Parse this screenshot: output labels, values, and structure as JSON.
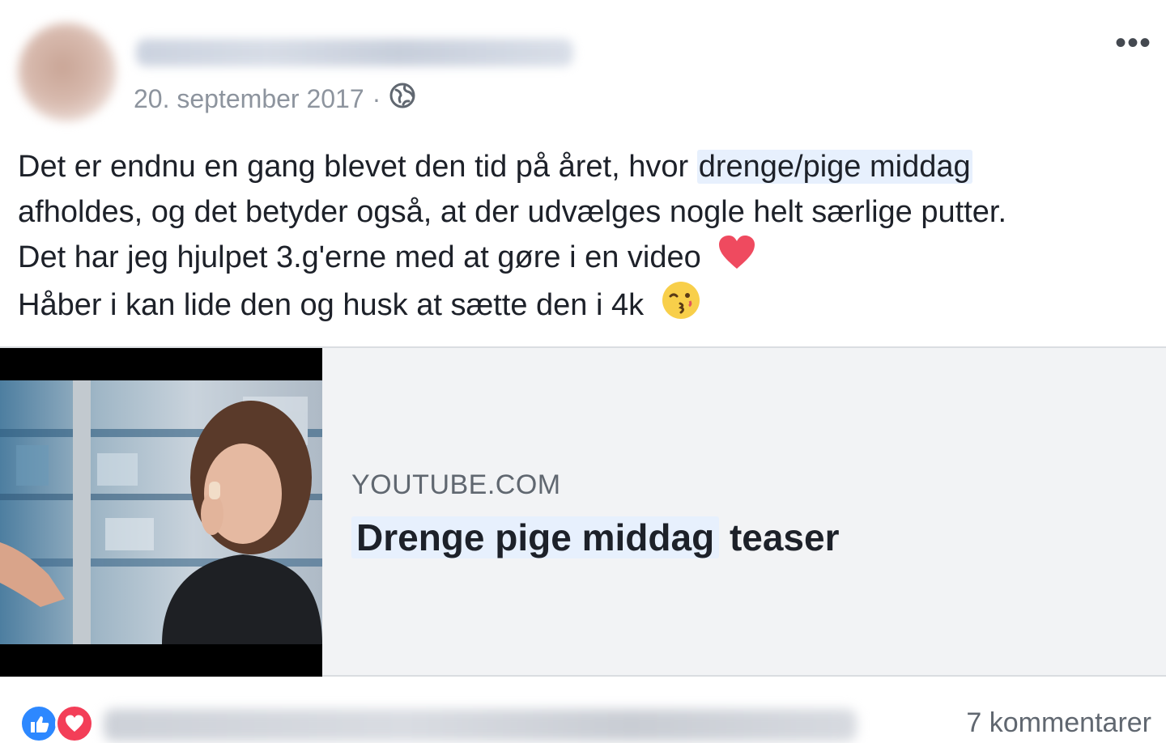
{
  "post": {
    "date": "20. september 2017",
    "separator": "·",
    "privacy_icon": "globe-icon",
    "more_label": "•••",
    "text": {
      "line1_before": "Det er endnu en gang blevet den tid på året, hvor ",
      "line1_tag": "drenge/pige middag",
      "line2": "afholdes, og det betyder også, at der udvælges nogle helt særlige putter.",
      "line3": "Det har jeg hjulpet 3.g'erne med at gøre i en video",
      "line4": "Håber i kan lide den og husk at sætte den i 4k"
    },
    "emojis": [
      "heart-emoji",
      "kissing-face-emoji"
    ]
  },
  "link_card": {
    "domain": "YOUTUBE.COM",
    "title_tag": "Drenge pige middag",
    "title_rest": " teaser"
  },
  "footer": {
    "reactions": [
      "like-icon",
      "love-icon"
    ],
    "comments_label": "7 kommentarer"
  },
  "colors": {
    "tag_highlight": "#e7f0fd",
    "card_bg": "#f2f3f5",
    "like_blue": "#2d88ff",
    "love_red": "#f33e58",
    "meta_gray": "#8d949e"
  }
}
